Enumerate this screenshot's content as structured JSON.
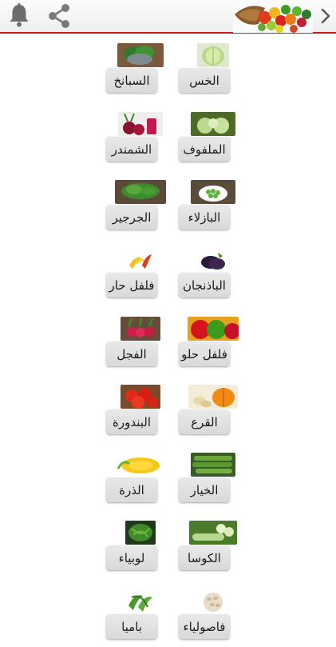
{
  "items": [
    {
      "label": "الخس",
      "icon": "lettuce-image"
    },
    {
      "label": "السبانخ",
      "icon": "spinach-image"
    },
    {
      "label": "الملفوف",
      "icon": "cabbage-image"
    },
    {
      "label": "الشمندر",
      "icon": "beetroot-image"
    },
    {
      "label": "البازلاء",
      "icon": "peas-image"
    },
    {
      "label": "الجرجير",
      "icon": "arugula-image"
    },
    {
      "label": "الباذنجان",
      "icon": "eggplant-image"
    },
    {
      "label": "فلفل حار",
      "icon": "hot-pepper-image"
    },
    {
      "label": "فلفل حلو",
      "icon": "sweet-pepper-image"
    },
    {
      "label": "الفجل",
      "icon": "radish-image"
    },
    {
      "label": "القرع",
      "icon": "pumpkin-image"
    },
    {
      "label": "البندورة",
      "icon": "tomato-image"
    },
    {
      "label": "الخيار",
      "icon": "cucumber-image"
    },
    {
      "label": "الذرة",
      "icon": "corn-image"
    },
    {
      "label": "الكوسا",
      "icon": "zucchini-image"
    },
    {
      "label": "لوبياء",
      "icon": "green-beans-image"
    },
    {
      "label": "فاصولياء",
      "icon": "white-beans-image"
    },
    {
      "label": "باميا",
      "icon": "okra-image"
    }
  ],
  "colors": {
    "accent": "#d01919",
    "button": "#dedede"
  },
  "header": {
    "left_icons": [
      "bell-icon",
      "share-icon"
    ],
    "right_icon": "chevron-right-icon",
    "banner": "vegetables-banner-image"
  }
}
